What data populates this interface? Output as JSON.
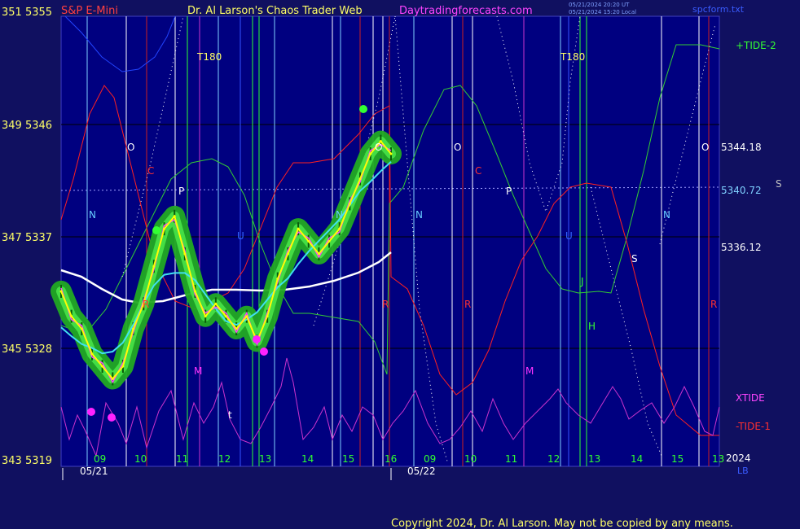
{
  "header": {
    "left_axis_top": "351  5355",
    "instrument": "S&P E-Mini",
    "author_title": "Dr. Al Larson's Chaos Trader Web",
    "website": "Daytradingforecasts.com",
    "timestamp_ut": "05/21/2024 20:20 UT",
    "timestamp_local": "05/21/2024 15:20 Local",
    "source_file": "spcform.txt"
  },
  "left_axis": [
    {
      "label": "351  5355",
      "y": 5355
    },
    {
      "label": "349  5346",
      "y": 5346
    },
    {
      "label": "347  5337",
      "y": 5337
    },
    {
      "label": "345  5328",
      "y": 5328
    },
    {
      "label": "343  5319",
      "y": 5319
    }
  ],
  "right_labels": {
    "tide2": "+TIDE-2",
    "xtide": "XTIDE",
    "tide1": "-TIDE-1",
    "p1": "5344.18",
    "p2": "5340.72",
    "p3": "5336.12",
    "s": "S",
    "year": "2024",
    "lb": "LB"
  },
  "x_axis": {
    "hours": [
      "09",
      "10",
      "11",
      "12",
      "13",
      "14",
      "15",
      "16",
      "09",
      "10",
      "11",
      "12",
      "13",
      "14",
      "15",
      "13"
    ],
    "dates": [
      "05/21",
      "05/22"
    ]
  },
  "copyright": "Copyright 2024, Dr. Al Larson. May not be copied by any means.",
  "markers": [
    {
      "t": "T180",
      "color": "#ffff66"
    },
    {
      "t": "T180",
      "color": "#ffff66"
    },
    {
      "t": "O",
      "color": "#ffffff"
    },
    {
      "t": "O",
      "color": "#ffffff"
    },
    {
      "t": "O",
      "color": "#ffffff"
    },
    {
      "t": "O",
      "color": "#ffffff"
    },
    {
      "t": "C",
      "color": "#ff3030"
    },
    {
      "t": "C",
      "color": "#ff3030"
    },
    {
      "t": "P",
      "color": "#ffffff"
    },
    {
      "t": "P",
      "color": "#ffffff"
    },
    {
      "t": "N",
      "color": "#66ccff"
    },
    {
      "t": "N",
      "color": "#66ccff"
    },
    {
      "t": "N",
      "color": "#66ccff"
    },
    {
      "t": "N",
      "color": "#66ccff"
    },
    {
      "t": "U",
      "color": "#3366ff"
    },
    {
      "t": "U",
      "color": "#3366ff"
    },
    {
      "t": "R",
      "color": "#ff3030"
    },
    {
      "t": "R",
      "color": "#ff3030"
    },
    {
      "t": "R",
      "color": "#ff3030"
    },
    {
      "t": "M",
      "color": "#ff33ff"
    },
    {
      "t": "M",
      "color": "#ff33ff"
    },
    {
      "t": "J",
      "color": "#33ff33"
    },
    {
      "t": "H",
      "color": "#33ff33"
    },
    {
      "t": "S",
      "color": "#ffffff"
    },
    {
      "t": "t",
      "color": "#ffffff"
    }
  ],
  "chart_data": {
    "type": "line",
    "title": "S&P E-Mini",
    "y_range": [
      5319,
      5355
    ],
    "grid": true,
    "series": [
      {
        "name": "price",
        "color": "#ffff00",
        "values": [
          5333,
          5331,
          5330,
          5328,
          5327,
          5326,
          5327,
          5330,
          5332,
          5335,
          5338,
          5339,
          5336,
          5333,
          5331,
          5332,
          5331,
          5330,
          5331,
          5329,
          5331,
          5334,
          5336,
          5338,
          5337,
          5336,
          5337,
          5338,
          5340,
          5342,
          5344,
          5345,
          5344
        ]
      },
      {
        "name": "+TIDE-2",
        "color": "#33cc33"
      },
      {
        "name": "XTIDE",
        "color": "#cc33cc"
      },
      {
        "name": "-TIDE-1",
        "color": "#ff2020"
      }
    ]
  }
}
